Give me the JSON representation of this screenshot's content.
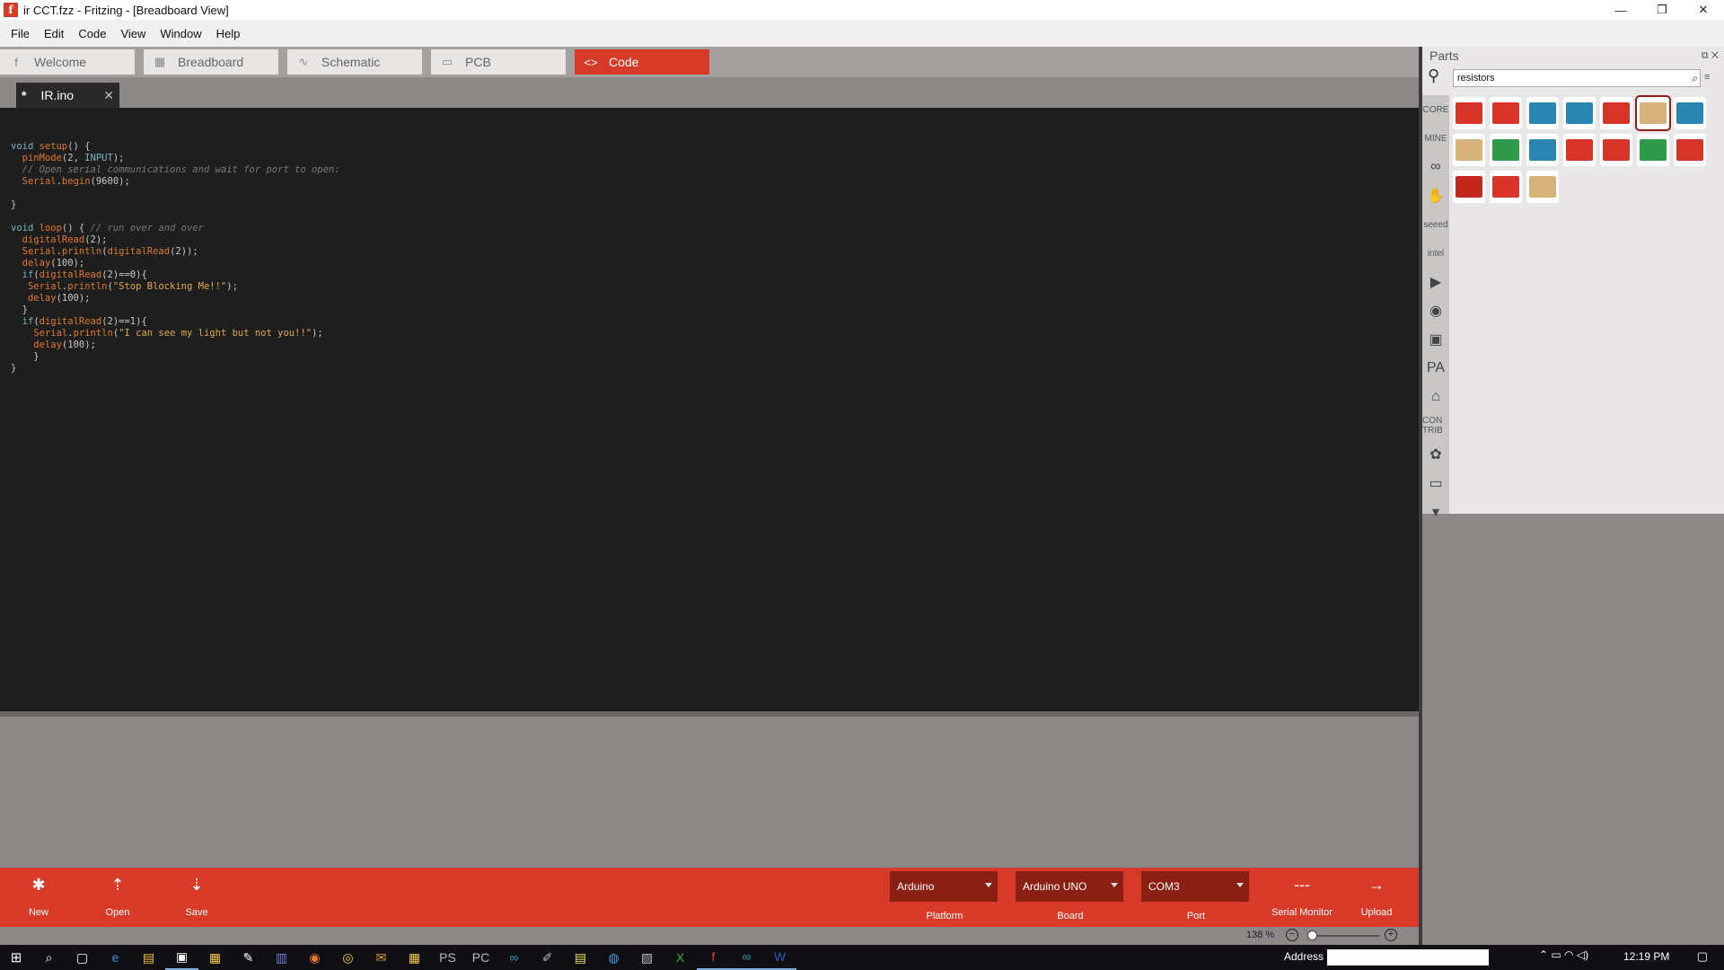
{
  "window": {
    "title": "ir CCT.fzz - Fritzing - [Breadboard View]",
    "app_icon_letter": "f",
    "minimize": "—",
    "maximize": "❐",
    "close": "✕"
  },
  "menu": [
    "File",
    "Edit",
    "Code",
    "View",
    "Window",
    "Help"
  ],
  "view_tabs": [
    {
      "label": "Welcome",
      "icon": "f"
    },
    {
      "label": "Breadboard",
      "icon": "▦"
    },
    {
      "label": "Schematic",
      "icon": "∿"
    },
    {
      "label": "PCB",
      "icon": "▭"
    },
    {
      "label": "Code",
      "icon": "<>"
    }
  ],
  "file_tab": {
    "marker": "*",
    "name": "IR.ino",
    "close": "✕"
  },
  "code_lines": [
    "void setup() {",
    "  pinMode(2, INPUT);",
    "  // Open serial communications and wait for port to open:",
    "  Serial.begin(9600);",
    "",
    "}",
    "",
    "void loop() { // run over and over",
    "  digitalRead(2);",
    "  Serial.println(digitalRead(2));",
    "  delay(100);",
    "  if(digitalRead(2)==0){",
    "   Serial.println(\"Stop Blocking Me!!\");",
    "   delay(100);",
    "  }",
    "  if(digitalRead(2)==1){",
    "    Serial.println(\"I can see my light but not you!!\");",
    "    delay(100);",
    "    }",
    "}"
  ],
  "toolbar": {
    "new": {
      "label": "New",
      "icon": "✱"
    },
    "open": {
      "label": "Open",
      "icon": "⇡"
    },
    "save": {
      "label": "Save",
      "icon": "⇣"
    },
    "platform": {
      "value": "Arduino",
      "label": "Platform"
    },
    "board": {
      "value": "Arduino UNO",
      "label": "Board"
    },
    "port": {
      "value": "COM3",
      "label": "Port"
    },
    "serial_monitor": {
      "label": "Serial Monitor",
      "icon": "---"
    },
    "upload": {
      "label": "Upload",
      "icon": "→"
    }
  },
  "zoom": {
    "text": "138 %",
    "out": "−",
    "in": "+",
    "level_fraction": 0.05
  },
  "parts": {
    "title": "Parts",
    "header_buttons": "⧉ ✕",
    "search_value": "resistors",
    "bins": [
      "CORE",
      "MINE",
      "∞",
      "✋",
      "seeed",
      "intel",
      "▶",
      "◉",
      "▣",
      "PA",
      "⌂",
      "CON TRIB",
      "✿",
      "▭",
      "▾"
    ],
    "items": [
      {
        "color": "#d8352a",
        "selected": false
      },
      {
        "color": "#d8352a",
        "selected": false
      },
      {
        "color": "#2a86b0",
        "selected": false
      },
      {
        "color": "#2a86b0",
        "selected": false
      },
      {
        "color": "#d8352a",
        "selected": false
      },
      {
        "color": "#d5b37a",
        "selected": true
      },
      {
        "color": "#2a86b0",
        "selected": false
      },
      {
        "color": "#d5b37a",
        "selected": false
      },
      {
        "color": "#2e9a4a",
        "selected": false
      },
      {
        "color": "#2a86b0",
        "selected": false
      },
      {
        "color": "#d8352a",
        "selected": false
      },
      {
        "color": "#d8352a",
        "selected": false
      },
      {
        "color": "#2e9a4a",
        "selected": false
      },
      {
        "color": "#d8352a",
        "selected": false
      },
      {
        "color": "#c2281e",
        "selected": false
      },
      {
        "color": "#d8352a",
        "selected": false
      },
      {
        "color": "#d5b37a",
        "selected": false
      }
    ]
  },
  "taskbar": {
    "start": "⊞",
    "apps": [
      "⌕",
      "▢",
      "e",
      "▤",
      "▣",
      "▦",
      "✎",
      "▥",
      "◉",
      "◎",
      "✉",
      "▦",
      "PS",
      "PC",
      "∞",
      "✐",
      "▤",
      "◍",
      "▧",
      "X",
      "f",
      "∞",
      "W"
    ],
    "address_label": "Address",
    "tray": "⌃ ▭ ◠ ◁)",
    "clock": "12:19 PM",
    "notification": "▢"
  },
  "colors": {
    "accent": "#d83a2a",
    "dark_accent": "#8b1f14",
    "editor_bg": "#1e1e1e"
  }
}
